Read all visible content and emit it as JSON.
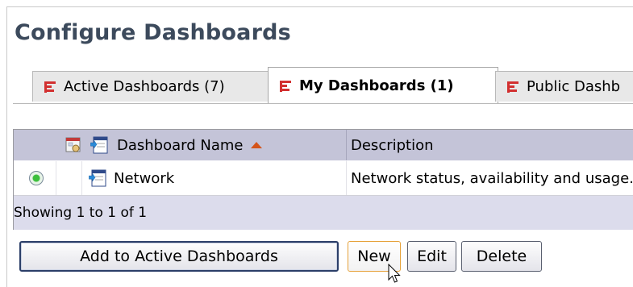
{
  "page": {
    "title": "Configure Dashboards"
  },
  "tabs": [
    {
      "label": "Active Dashboards (7)",
      "active": false
    },
    {
      "label": "My Dashboards (1)",
      "active": true
    },
    {
      "label": "Public Dashb",
      "active": false
    }
  ],
  "grid": {
    "columns": {
      "name": "Dashboard Name",
      "description": "Description"
    },
    "rows": [
      {
        "name": "Network",
        "description": "Network status, availability and usage.",
        "selected": true
      }
    ],
    "footer": "Showing 1 to 1 of 1"
  },
  "buttons": {
    "add_active": "Add to Active Dashboards",
    "new": "New",
    "edit": "Edit",
    "delete": "Delete"
  },
  "colors": {
    "title": "#3c4a5c",
    "tab_icon": "#d23030",
    "header_bg": "#c4c4d8",
    "footer_bg": "#dcdcec",
    "sort_arrow": "#d4541a"
  },
  "icons": [
    "dashboard-tab-icon",
    "share-column-icon",
    "dashboard-column-icon",
    "sort-ascending-icon",
    "radio-selected-icon",
    "dashboard-row-icon",
    "mouse-cursor-icon"
  ]
}
